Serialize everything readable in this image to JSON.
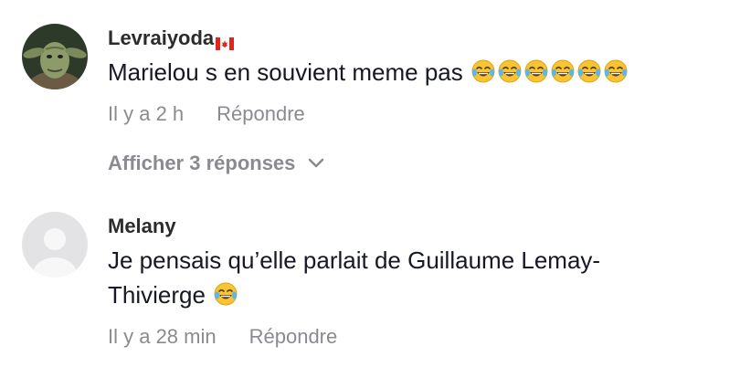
{
  "comments": [
    {
      "username": "Levraiyoda",
      "flag_icon": "canada-flag-icon",
      "text": "Marielou s en souvient meme pas",
      "emoji_icon": "face-with-tears-of-joy-icon",
      "emoji_count": 6,
      "time": "Il y a 2 h",
      "reply_label": "Répondre"
    },
    {
      "username": "Melany",
      "text_line1": "Je pensais qu’elle parlait de Guillaume Lemay-",
      "text_line2": "Thivierge",
      "emoji_icon": "face-with-tears-of-joy-icon",
      "emoji_count": 1,
      "time": "Il y a 28 min",
      "reply_label": "Répondre"
    }
  ],
  "show_replies": {
    "label": "Afficher 3 réponses",
    "icon": "chevron-down-icon"
  },
  "colors": {
    "username": "#2b2b2b",
    "text": "#161823",
    "meta": "#8a8b91",
    "default_avatar_bg": "#e3e3e6",
    "default_avatar_fg": "#f7f7f8"
  }
}
